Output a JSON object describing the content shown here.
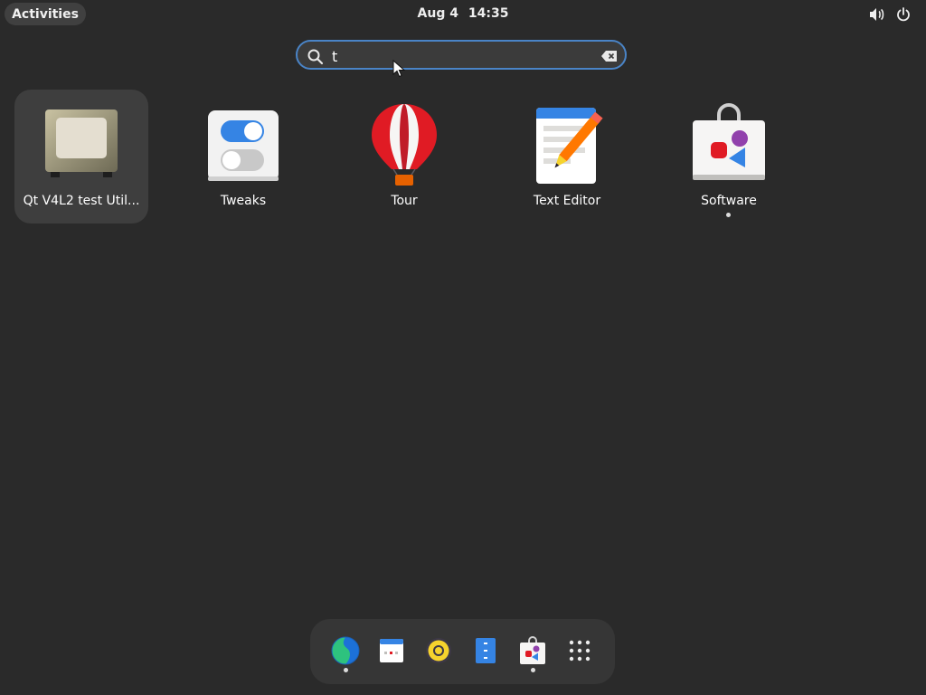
{
  "topbar": {
    "activities_label": "Activities",
    "date": "Aug 4",
    "time": "14:35",
    "icons": [
      "volume-icon",
      "power-icon"
    ]
  },
  "search": {
    "value": "t",
    "icon": "search-icon",
    "clear_icon": "clear-icon"
  },
  "results": [
    {
      "label": "Qt V4L2 test Util...",
      "icon": "webcam-app-icon",
      "selected": true,
      "running": false
    },
    {
      "label": "Tweaks",
      "icon": "tweaks-icon",
      "selected": false,
      "running": false
    },
    {
      "label": "Tour",
      "icon": "balloon-icon",
      "selected": false,
      "running": false
    },
    {
      "label": "Text Editor",
      "icon": "text-editor-icon",
      "selected": false,
      "running": false
    },
    {
      "label": "Software",
      "icon": "software-bag-icon",
      "selected": false,
      "running": true
    }
  ],
  "dash": {
    "items": [
      {
        "icon": "web-browser-icon",
        "running": true
      },
      {
        "icon": "calendar-icon",
        "running": false
      },
      {
        "icon": "music-player-icon",
        "running": false
      },
      {
        "icon": "files-icon",
        "running": false
      },
      {
        "icon": "software-bag-icon",
        "running": true
      },
      {
        "icon": "app-grid-icon",
        "running": false
      }
    ]
  },
  "colors": {
    "background": "#2a2a2a",
    "search_focus_ring": "#4a84c7",
    "selected_tile": "#3e3e3e",
    "dash_background": "#363636"
  }
}
